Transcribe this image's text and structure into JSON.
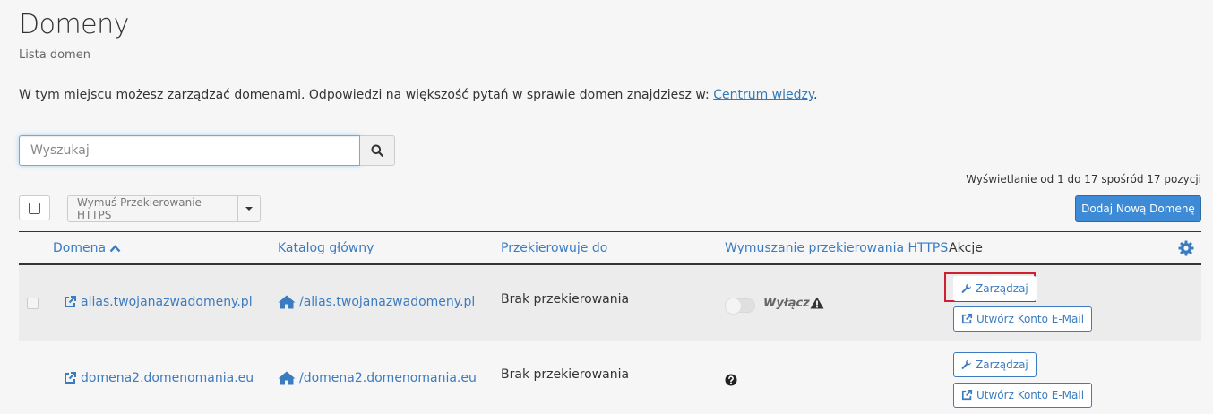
{
  "header": {
    "title": "Domeny",
    "subtitle": "Lista domen"
  },
  "intro": {
    "text": "W tym miejscu możesz zarządzać domenami. Odpowiedzi na większość pytań w sprawie domen znajdziesz w: ",
    "link_label": "Centrum wiedzy",
    "suffix": "."
  },
  "search": {
    "placeholder": "Wyszukaj",
    "value": ""
  },
  "pagination": {
    "info": "Wyświetlanie od 1 do 17 spośród 17 pozycji"
  },
  "toolbar": {
    "bulk_action_label": "Wymuś Przekierowanie HTTPS",
    "add_domain_label": "Dodaj Nową Domenę"
  },
  "table": {
    "columns": {
      "domain": "Domena",
      "docroot": "Katalog główny",
      "redirect": "Przekierowuje do",
      "https": "Wymuszanie przekierowania HTTPS",
      "actions": "Akcje"
    },
    "rows": [
      {
        "domain": "alias.twojanazwadomeny.pl",
        "docroot": "/alias.twojanazwadomeny.pl",
        "redirect": "Brak przekierowania",
        "https_label": "Wyłącz",
        "manage_label": "Zarządzaj",
        "email_label": "Utwórz Konto E-Mail"
      },
      {
        "domain": "domena2.domenomania.eu",
        "docroot": "/domena2.domenomania.eu",
        "redirect": "Brak przekierowania",
        "manage_label": "Zarządzaj",
        "email_label": "Utwórz Konto E-Mail"
      }
    ]
  },
  "colors": {
    "link": "#3b7cc1",
    "primary_button": "#3d8ad6",
    "highlight": "#cf2030"
  }
}
